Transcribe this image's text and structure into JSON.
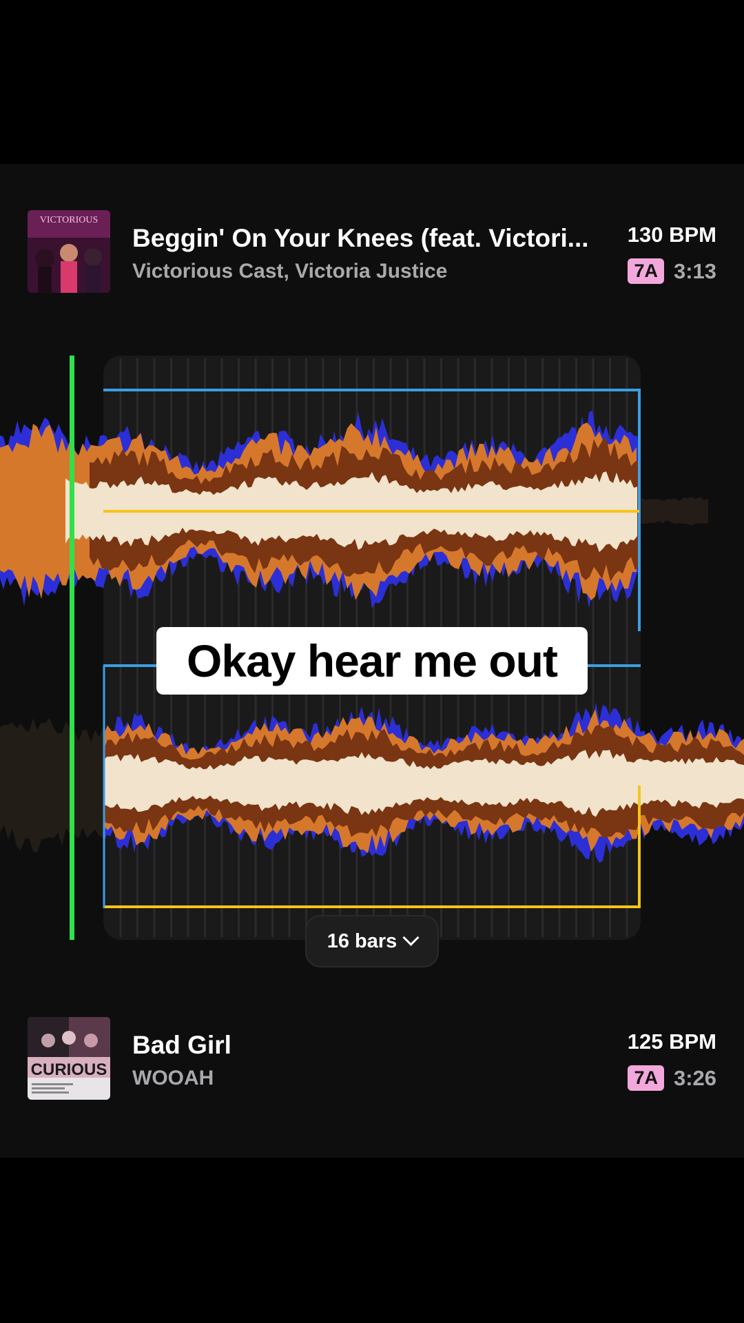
{
  "track_a": {
    "title": "Beggin' On Your Knees (feat. Victori...",
    "artist": "Victorious Cast, Victoria Justice",
    "bpm": "130 BPM",
    "key": "7A",
    "duration": "3:13",
    "art_text": "VICTORIOUS"
  },
  "track_b": {
    "title": "Bad Girl",
    "artist": "WOOAH",
    "bpm": "125 BPM",
    "key": "7A",
    "duration": "3:26",
    "art_text": "CURIOUS"
  },
  "caption": "Okay hear me out",
  "loop_length": {
    "label": "16 bars",
    "icon": "chevron-down-icon"
  },
  "colors": {
    "playhead": "#31e04b",
    "loop_blue": "#3b9ee6",
    "loop_yellow": "#f5c518",
    "wave_blue": "#2c2fd6",
    "wave_orange": "#d6782c",
    "wave_brown": "#7a3512",
    "wave_core": "#f1e3cc",
    "key_badge": "#f3a8dc"
  }
}
